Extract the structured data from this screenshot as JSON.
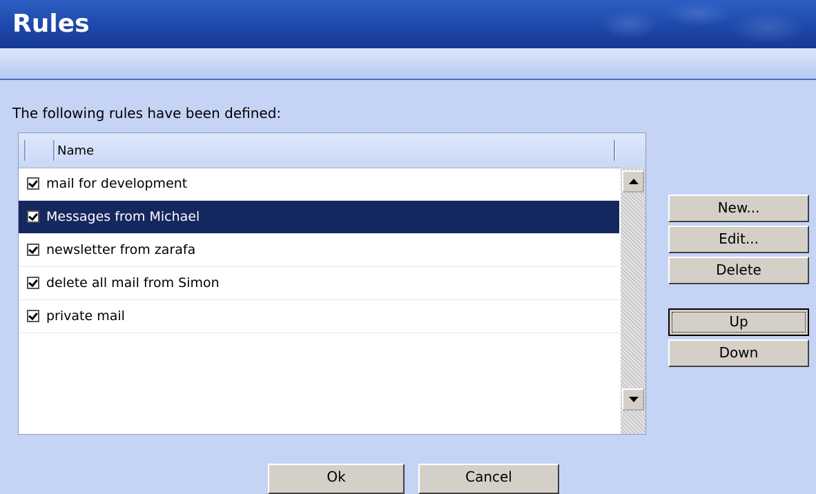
{
  "window": {
    "title": "Rules"
  },
  "heading": "The following rules have been defined:",
  "list": {
    "column_name": "Name",
    "rows": [
      {
        "label": "mail for development",
        "checked": true,
        "selected": false
      },
      {
        "label": "Messages from Michael",
        "checked": true,
        "selected": true
      },
      {
        "label": "newsletter from zarafa",
        "checked": true,
        "selected": false
      },
      {
        "label": "delete all mail from Simon",
        "checked": true,
        "selected": false
      },
      {
        "label": "private mail",
        "checked": true,
        "selected": false
      }
    ]
  },
  "buttons": {
    "new": "New...",
    "edit": "Edit...",
    "delete": "Delete",
    "up": "Up",
    "down": "Down",
    "ok": "Ok",
    "cancel": "Cancel"
  }
}
